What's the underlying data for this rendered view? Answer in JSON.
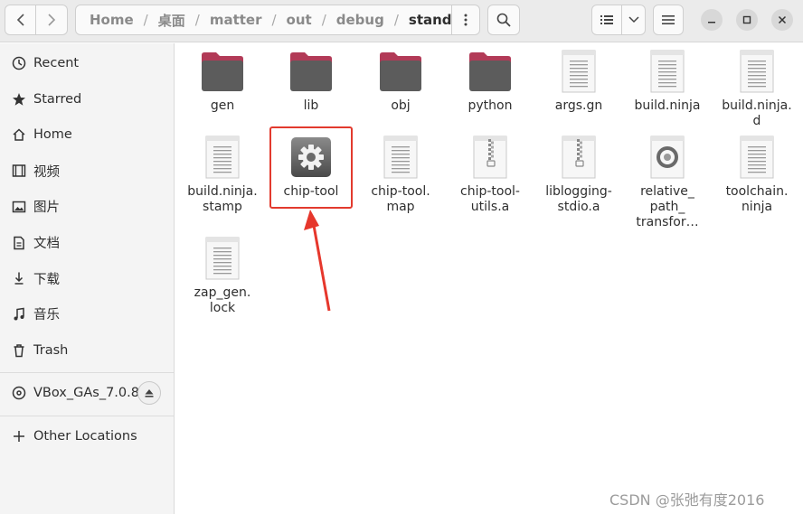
{
  "header": {
    "path": [
      "Home",
      "桌面",
      "matter",
      "out",
      "debug",
      "standalone"
    ],
    "separator": "/"
  },
  "sidebar": {
    "items": [
      {
        "label": "Recent",
        "icon": "clock-icon"
      },
      {
        "label": "Starred",
        "icon": "star-icon"
      },
      {
        "label": "Home",
        "icon": "home-icon"
      },
      {
        "label": "视频",
        "icon": "video-icon"
      },
      {
        "label": "图片",
        "icon": "picture-icon"
      },
      {
        "label": "文档",
        "icon": "document-icon"
      },
      {
        "label": "下载",
        "icon": "download-icon"
      },
      {
        "label": "音乐",
        "icon": "music-icon"
      },
      {
        "label": "Trash",
        "icon": "trash-icon"
      }
    ],
    "device": {
      "label": "VBox_GAs_7.0.8",
      "icon": "disc-icon"
    },
    "other": {
      "label": "Other Locations",
      "icon": "plus-icon"
    }
  },
  "files": [
    {
      "name": "gen",
      "kind": "folder"
    },
    {
      "name": "lib",
      "kind": "folder"
    },
    {
      "name": "obj",
      "kind": "folder"
    },
    {
      "name": "python",
      "kind": "folder"
    },
    {
      "name": "args.gn",
      "kind": "text"
    },
    {
      "name": "build.ninja",
      "kind": "text"
    },
    {
      "name": "build.ninja.\nd",
      "kind": "text"
    },
    {
      "name": "build.ninja.\nstamp",
      "kind": "text"
    },
    {
      "name": "chip-tool",
      "kind": "executable"
    },
    {
      "name": "chip-tool.\nmap",
      "kind": "text"
    },
    {
      "name": "chip-tool-\nutils.a",
      "kind": "archive"
    },
    {
      "name": "liblogging-\nstdio.a",
      "kind": "archive"
    },
    {
      "name": "relative_\npath_\ntransfor…",
      "kind": "json"
    },
    {
      "name": "toolchain.\nninja",
      "kind": "text"
    },
    {
      "name": "zap_gen.\nlock",
      "kind": "text"
    }
  ],
  "watermark": "CSDN @张弛有度2016",
  "colors": {
    "folder": "#5c5c5c",
    "folder_tab": "#b23a57",
    "highlight": "#e23a2e"
  }
}
